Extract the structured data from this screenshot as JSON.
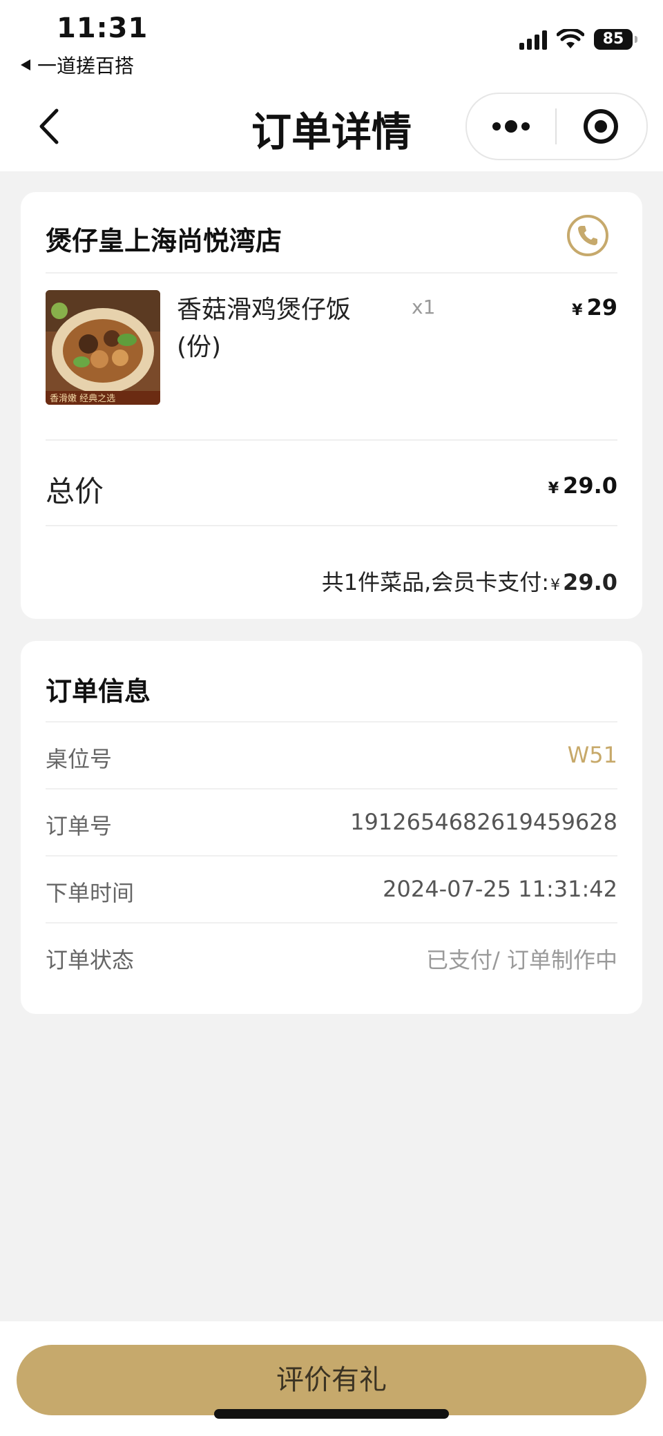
{
  "status_bar": {
    "time": "11:31",
    "back_app_label": "一道搓百搭",
    "battery": "85"
  },
  "nav": {
    "title": "订单详情"
  },
  "order_card": {
    "store_name": "煲仔皇上海尚悦湾店",
    "items": [
      {
        "name": "香菇滑鸡煲仔饭(份)",
        "quantity": "x1",
        "currency": "¥",
        "price": "29"
      }
    ],
    "total_label": "总价",
    "total_currency": "¥",
    "total_value": "29.0",
    "summary_prefix": "共1件菜品,会员卡支付:",
    "summary_currency": "¥",
    "summary_amount": "29.0",
    "image_caption": "香滑嫩  经典之选"
  },
  "order_info": {
    "title": "订单信息",
    "rows": [
      {
        "label": "桌位号",
        "value": "W51"
      },
      {
        "label": "订单号",
        "value": "1912654682619459628"
      },
      {
        "label": "下单时间",
        "value": "2024-07-25 11:31:42"
      },
      {
        "label": "订单状态",
        "value": "已支付/ 订单制作中"
      }
    ]
  },
  "bottom": {
    "review_button": "评价有礼"
  },
  "colors": {
    "accent_gold": "#c6a96c",
    "background": "#f2f2f2"
  },
  "icons": {
    "back": "chevron-left-icon",
    "more": "more-dots-icon",
    "close": "target-icon",
    "phone": "phone-icon"
  }
}
